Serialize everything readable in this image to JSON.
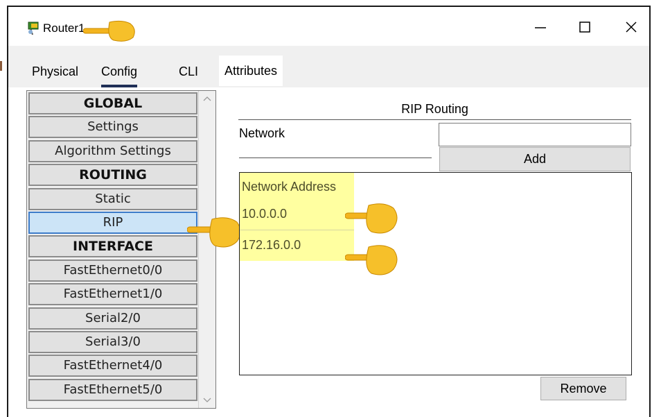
{
  "window": {
    "title": "Router1",
    "controls": {
      "minimize": "—",
      "maximize": "☐",
      "close": "✕"
    }
  },
  "tabs": [
    {
      "label": "Physical"
    },
    {
      "label": "Config",
      "active": true
    },
    {
      "label": "CLI"
    },
    {
      "label": "Attributes"
    }
  ],
  "sidebar": {
    "items": [
      {
        "label": "GLOBAL",
        "header": true
      },
      {
        "label": "Settings"
      },
      {
        "label": "Algorithm Settings"
      },
      {
        "label": "ROUTING",
        "header": true
      },
      {
        "label": "Static"
      },
      {
        "label": "RIP",
        "selected": true
      },
      {
        "label": "INTERFACE",
        "header": true
      },
      {
        "label": "FastEthernet0/0"
      },
      {
        "label": "FastEthernet1/0"
      },
      {
        "label": "Serial2/0"
      },
      {
        "label": "Serial3/0"
      },
      {
        "label": "FastEthernet4/0"
      },
      {
        "label": "FastEthernet5/0"
      }
    ]
  },
  "rip": {
    "title": "RIP Routing",
    "network_label": "Network",
    "network_value": "",
    "add_label": "Add",
    "remove_label": "Remove",
    "table": {
      "header": "Network Address",
      "rows": [
        "10.0.0.0",
        "172.16.0.0"
      ]
    }
  },
  "icons": {
    "app": "router-icon",
    "pointer": "pointing-hand-emoji"
  },
  "colors": {
    "selected_item_bg": "#cce4f7",
    "selected_item_border": "#3d7cc9",
    "table_highlight": "#ffffa0",
    "tab_underline": "#1f2e56"
  }
}
